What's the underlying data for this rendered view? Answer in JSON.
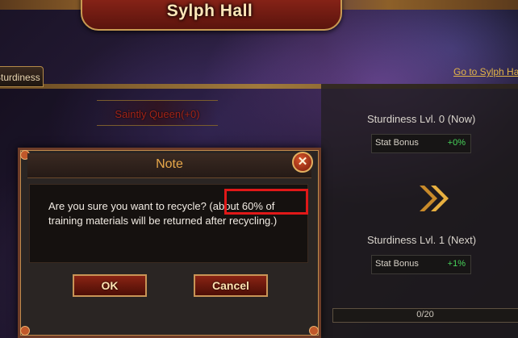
{
  "header": {
    "title": "Sylph Hall"
  },
  "tabs": [
    {
      "label": "Sturdiness"
    }
  ],
  "links": {
    "goto": "Go to Sylph Hall"
  },
  "hero": {
    "name": "Saintly Queen(+0)"
  },
  "stats": {
    "now_title": "Sturdiness Lvl. 0 (Now)",
    "now_label": "Stat Bonus",
    "now_value": "+0%",
    "next_title": "Sturdiness Lvl. 1 (Next)",
    "next_label": "Stat Bonus",
    "next_value": "+1%",
    "progress_text": "0/20",
    "progress_fraction": 0.0
  },
  "dialog": {
    "title": "Note",
    "close_glyph": "✕",
    "message_line1": "Are you sure you want to recycle? (about 60% of",
    "message_line2": "training materials will be returned after recycling.)",
    "ok_label": "OK",
    "cancel_label": "Cancel"
  },
  "colors": {
    "accent_gold": "#e3b448",
    "button_red": "#8a2414",
    "highlight_red": "#e01818",
    "bonus_green": "#48d45a",
    "hero_name_red": "#d83020"
  }
}
